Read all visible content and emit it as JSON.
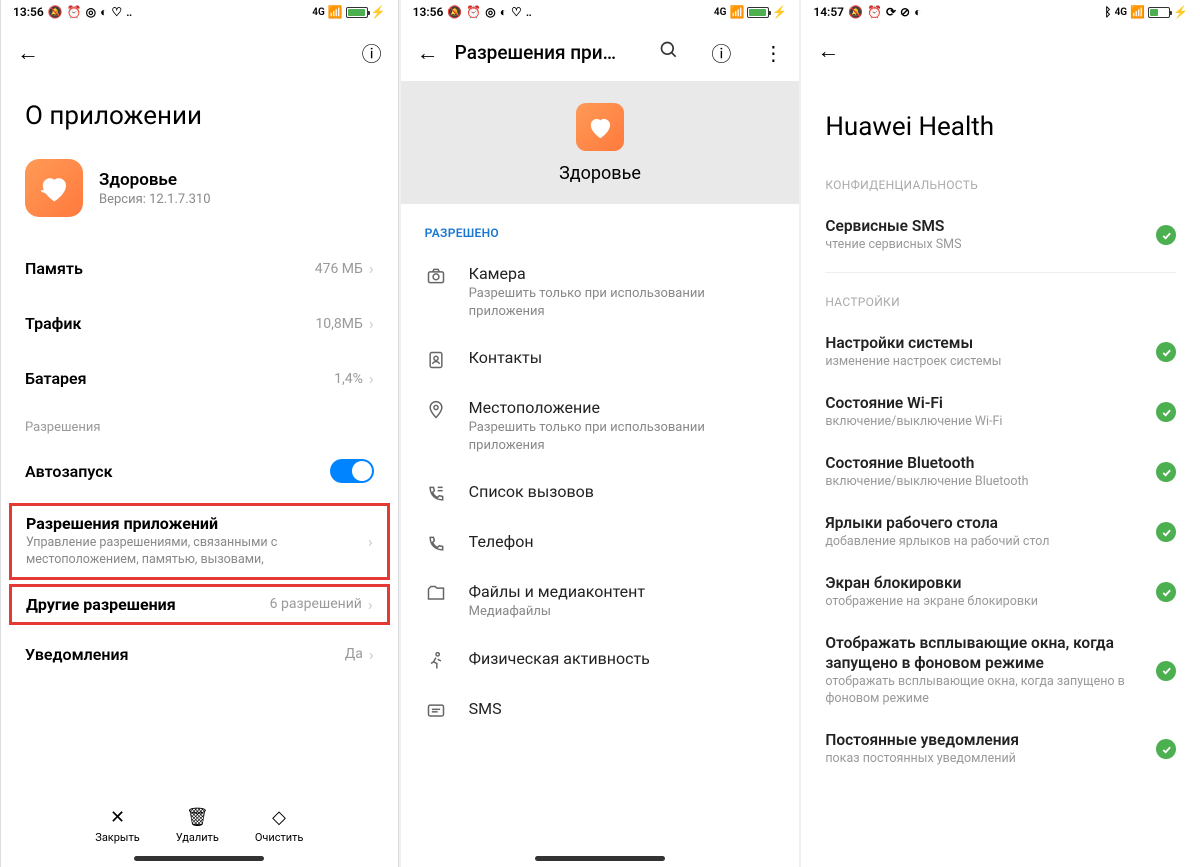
{
  "s1": {
    "time": "13:56",
    "net": "4G",
    "batt": "87",
    "title": "О приложении",
    "app_name": "Здоровье",
    "version_label": "Версия: 12.1.7.310",
    "rows": {
      "memory": {
        "label": "Память",
        "value": "476 МБ"
      },
      "traffic": {
        "label": "Трафик",
        "value": "10,8МБ"
      },
      "battery": {
        "label": "Батарея",
        "value": "1,4%"
      }
    },
    "perm_section": "Разрешения",
    "autostart": "Автозапуск",
    "app_perms": {
      "title": "Разрешения приложений",
      "sub": "Управление разрешениями, связанными с местоположением, памятью, вызовами,"
    },
    "other_perms": {
      "title": "Другие разрешения",
      "value": "6 разрешений"
    },
    "notifications": {
      "label": "Уведомления",
      "value": "Да"
    },
    "actions": {
      "close": "Закрыть",
      "delete": "Удалить",
      "clear": "Очистить"
    }
  },
  "s2": {
    "time": "13:56",
    "net": "4G",
    "batt": "87",
    "header": "Разрешения при…",
    "app_name": "Здоровье",
    "allowed": "РАЗРЕШЕНО",
    "perms": [
      {
        "title": "Камера",
        "sub": "Разрешить только при использовании приложения",
        "icon": "camera"
      },
      {
        "title": "Контакты",
        "sub": "",
        "icon": "contacts"
      },
      {
        "title": "Местоположение",
        "sub": "Разрешить только при использовании приложения",
        "icon": "location"
      },
      {
        "title": "Список вызовов",
        "sub": "",
        "icon": "calllog"
      },
      {
        "title": "Телефон",
        "sub": "",
        "icon": "phone"
      },
      {
        "title": "Файлы и медиаконтент",
        "sub": "Медиафайлы",
        "icon": "files"
      },
      {
        "title": "Физическая активность",
        "sub": "",
        "icon": "activity"
      },
      {
        "title": "SMS",
        "sub": "",
        "icon": "sms"
      }
    ]
  },
  "s3": {
    "time": "14:57",
    "net": "4G",
    "batt": "43",
    "title": "Huawei Health",
    "sec_privacy": "КОНФИДЕНЦИАЛЬНОСТЬ",
    "sec_settings": "НАСТРОЙКИ",
    "privacy": [
      {
        "t": "Сервисные SMS",
        "s": "чтение сервисных SMS"
      }
    ],
    "settings": [
      {
        "t": "Настройки системы",
        "s": "изменение настроек системы"
      },
      {
        "t": "Состояние Wi-Fi",
        "s": "включение/выключение Wi-Fi"
      },
      {
        "t": "Состояние Bluetooth",
        "s": "включение/выключение Bluetooth"
      },
      {
        "t": "Ярлыки рабочего стола",
        "s": "добавление ярлыков на рабочий стол"
      },
      {
        "t": "Экран блокировки",
        "s": "отображение на экране блокировки"
      },
      {
        "t": "Отображать всплывающие окна, когда запущено в фоновом режиме",
        "s": "отображать всплывающие окна, когда запущено в фоновом режиме"
      },
      {
        "t": "Постоянные уведомления",
        "s": "показ постоянных уведомлений"
      }
    ]
  }
}
